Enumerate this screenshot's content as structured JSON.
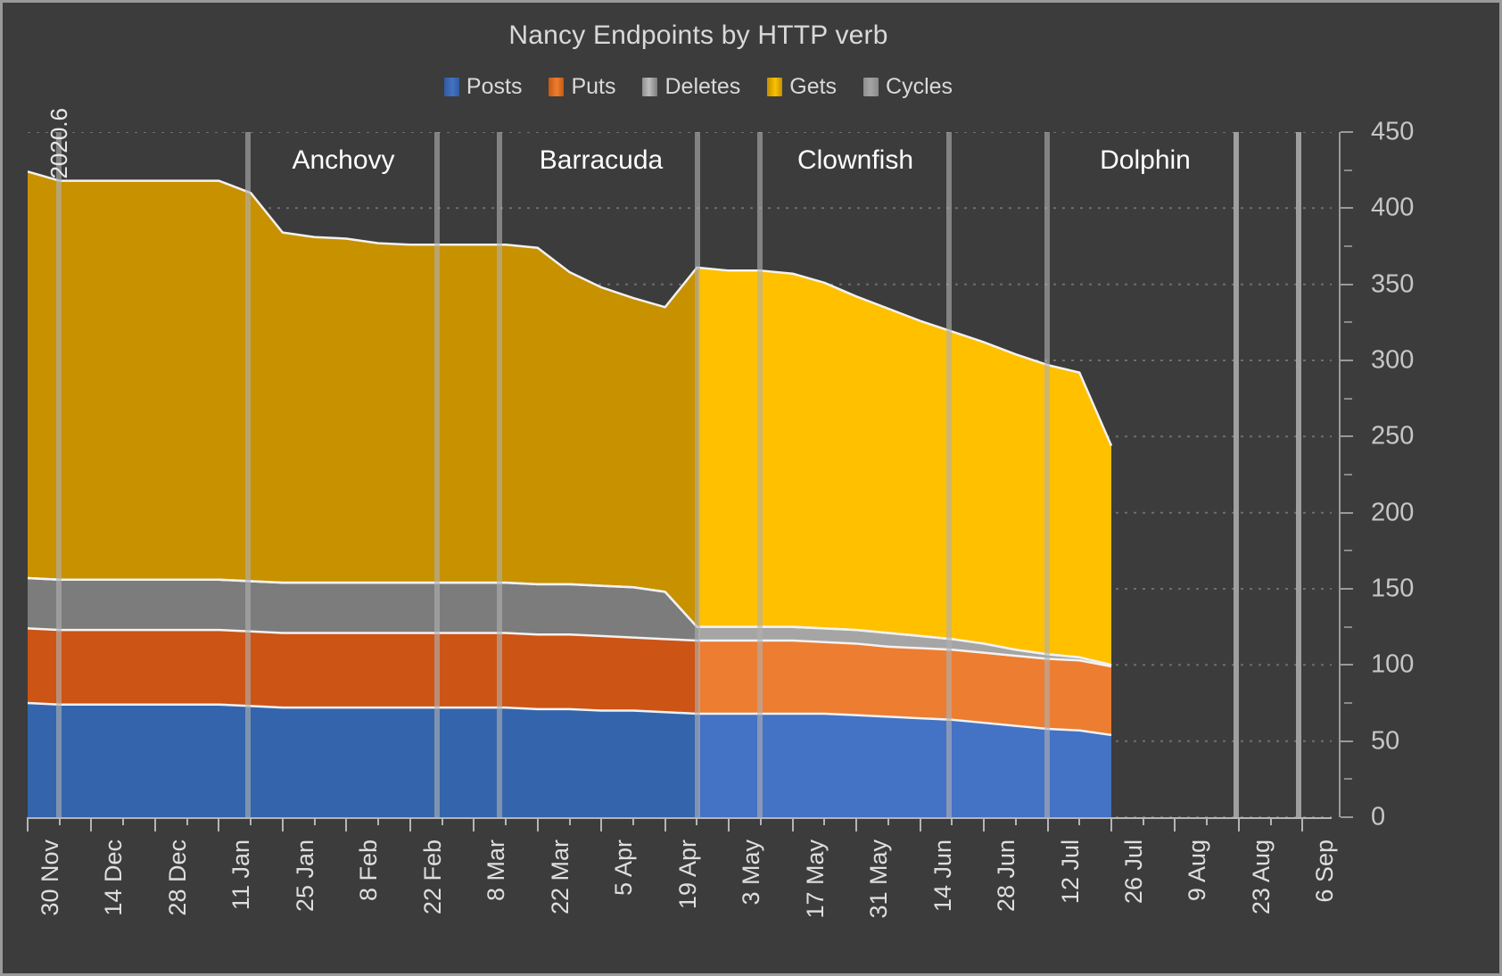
{
  "chart_data": {
    "type": "area",
    "stacked": true,
    "title": "Nancy Endpoints by HTTP verb",
    "xlabel": "",
    "ylabel": "",
    "ylim": [
      0,
      450
    ],
    "ytick_step": 50,
    "y_axis_position": "right",
    "grid": "horizontal-dotted",
    "legend_position": "top-center",
    "legend": [
      "Posts",
      "Puts",
      "Deletes",
      "Gets",
      "Cycles"
    ],
    "colors": {
      "posts": "#3465ac",
      "puts": "#cc5415",
      "deletes": "#7c7c7c",
      "gets": "#c79100",
      "cycles": "#8f8f8f",
      "posts_bright": "#4472c4",
      "puts_bright": "#ed7d31",
      "deletes_bright": "#a5a5a5",
      "gets_bright": "#ffc000",
      "background": "#3c3c3c",
      "text": "#d9d9d9",
      "axis": "#9a9a9a",
      "milestone_line": "#b0b0b0"
    },
    "ytick_labels": [
      "0",
      "50",
      "100",
      "150",
      "200",
      "250",
      "300",
      "350",
      "400",
      "450"
    ],
    "xtick_labels": [
      "30 Nov",
      "14 Dec",
      "28 Dec",
      "11 Jan",
      "25 Jan",
      "8 Feb",
      "22 Feb",
      "8 Mar",
      "22 Mar",
      "5 Apr",
      "19 Apr",
      "3 May",
      "17 May",
      "31 May",
      "14 Jun",
      "28 Jun",
      "12 Jul",
      "26 Jul",
      "9 Aug",
      "23 Aug",
      "6 Sep"
    ],
    "start_annotation": "2020.6",
    "milestones": [
      {
        "label": "Anchovy",
        "center_date": "11 Jan"
      },
      {
        "label": "Barracuda",
        "center_date": "22 Feb"
      },
      {
        "label": "Clownfish",
        "center_date": "10 May"
      },
      {
        "label": "Dolphin",
        "center_date": "19 Jul"
      }
    ],
    "x": [
      "30 Nov",
      "7 Dec",
      "14 Dec",
      "21 Dec",
      "28 Dec",
      "4 Jan",
      "11 Jan",
      "18 Jan",
      "25 Jan",
      "1 Feb",
      "8 Feb",
      "15 Feb",
      "22 Feb",
      "1 Mar",
      "8 Mar",
      "15 Mar",
      "22 Mar",
      "29 Mar",
      "5 Apr",
      "12 Apr",
      "19 Apr",
      "26 Apr",
      "3 May",
      "10 May",
      "17 May",
      "24 May",
      "31 May",
      "7 Jun",
      "14 Jun",
      "21 Jun",
      "28 Jun",
      "5 Jul",
      "12 Jul",
      "19 Jul",
      "26 Jul"
    ],
    "series": [
      {
        "name": "Posts",
        "color": "#3465ac",
        "values": [
          75,
          74,
          74,
          74,
          74,
          74,
          74,
          73,
          72,
          72,
          72,
          72,
          72,
          72,
          72,
          72,
          71,
          71,
          70,
          70,
          69,
          68,
          68,
          68,
          68,
          68,
          67,
          66,
          65,
          64,
          62,
          60,
          58,
          57,
          54
        ]
      },
      {
        "name": "Puts",
        "color": "#cc5415",
        "values": [
          49,
          49,
          49,
          49,
          49,
          49,
          49,
          49,
          49,
          49,
          49,
          49,
          49,
          49,
          49,
          49,
          49,
          49,
          49,
          48,
          48,
          48,
          48,
          48,
          48,
          47,
          47,
          46,
          46,
          46,
          46,
          46,
          46,
          46,
          45
        ]
      },
      {
        "name": "Deletes",
        "color": "#7c7c7c",
        "values": [
          33,
          33,
          33,
          33,
          33,
          33,
          33,
          33,
          33,
          33,
          33,
          33,
          33,
          33,
          33,
          33,
          33,
          33,
          33,
          33,
          31,
          9,
          9,
          9,
          9,
          9,
          9,
          9,
          8,
          7,
          6,
          4,
          3,
          2,
          1
        ]
      },
      {
        "name": "Gets",
        "color": "#c79100",
        "values": [
          267,
          262,
          262,
          262,
          262,
          262,
          262,
          255,
          230,
          227,
          226,
          223,
          222,
          222,
          222,
          222,
          221,
          205,
          196,
          190,
          187,
          236,
          234,
          234,
          232,
          227,
          219,
          213,
          207,
          202,
          198,
          194,
          190,
          187,
          144
        ]
      },
      {
        "name": "Cycles",
        "color": "#8f8f8f",
        "values": [
          0,
          0,
          0,
          0,
          0,
          0,
          0,
          0,
          0,
          0,
          0,
          0,
          0,
          0,
          0,
          0,
          0,
          0,
          0,
          0,
          0,
          0,
          0,
          0,
          0,
          0,
          0,
          0,
          0,
          0,
          0,
          0,
          0,
          0,
          0
        ]
      }
    ],
    "totals_note": "Stacked totals start at ~424 on 30 Nov and decline to ~244 by 26 Jul"
  }
}
